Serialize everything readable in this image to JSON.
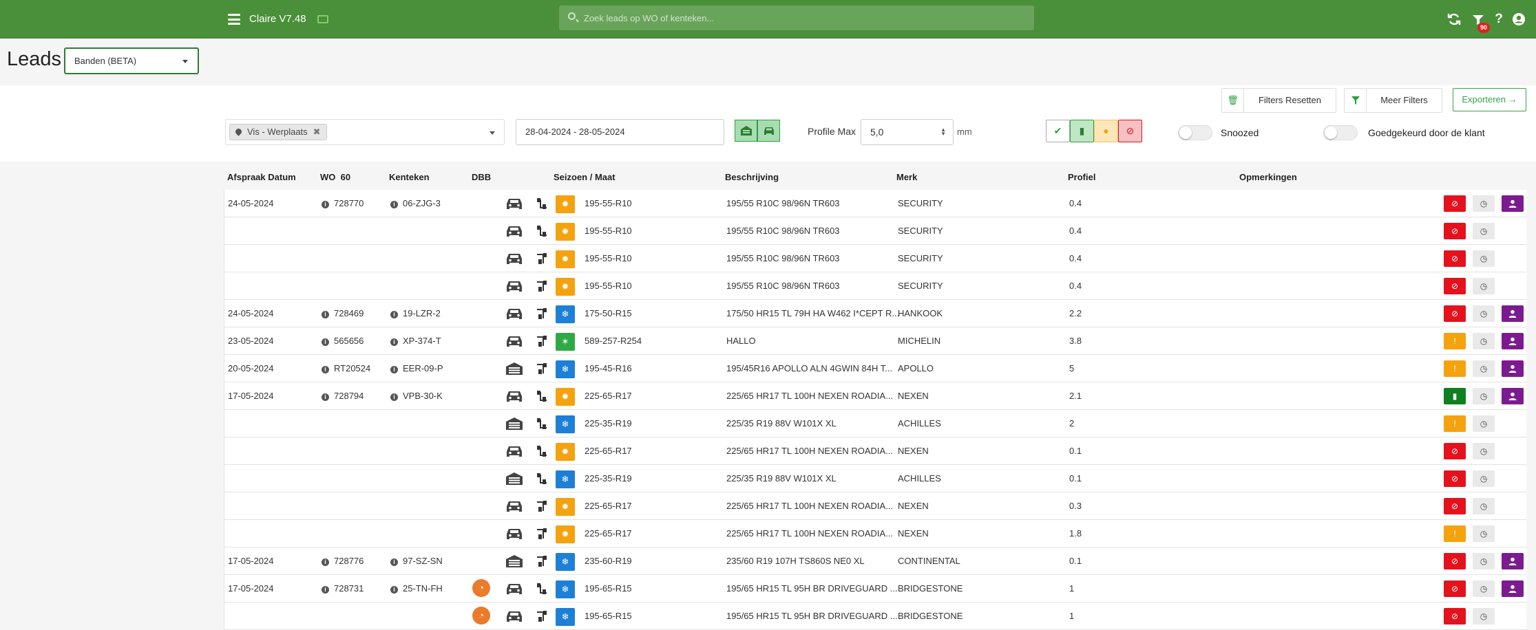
{
  "topbar": {
    "title": "Claire V7.48",
    "search_placeholder": "Zoek leads op WO of kenteken...",
    "badge": "90",
    "icons": [
      "cast-icon",
      "refresh-icon",
      "inbox-icon",
      "help-icon",
      "user-icon"
    ]
  },
  "header": {
    "title": "Leads",
    "type_select": "Banden (BETA)"
  },
  "filters": {
    "reset_label": "Filters Resetten",
    "more_label": "Meer Filters",
    "export_label": "Exporteren",
    "location_chip": "Vis - Werplaats",
    "date_range": "28-04-2024 - 28-05-2024",
    "profile_label": "Profile Max",
    "profile_value": "5,0",
    "profile_unit": "mm",
    "snoozed_label": "Snoozed",
    "approved_label": "Goedgekeurd door de klant",
    "colors": {
      "green": "#35a34a",
      "orange": "#f5a20f",
      "red": "#e3121d",
      "purple": "#7b1b8f"
    }
  },
  "table": {
    "headers": {
      "date": "Afspraak Datum",
      "wo": "WO",
      "wo_count": "60",
      "plate": "Kenteken",
      "dbb": "DBB",
      "season_size": "Seizoen / Maat",
      "description": "Beschrijving",
      "brand": "Merk",
      "profile": "Profiel",
      "remarks": "Opmerkingen"
    },
    "rows": [
      {
        "date": "24-05-2024",
        "wo": "728770",
        "plate": "06-ZJG-3",
        "dbb": false,
        "vehicle": "car",
        "axle": "front",
        "season": "summer",
        "size": "195-55-R10",
        "desc": "195/55 R10C 98/96N TR603",
        "brand": "SECURITY",
        "profile": "0.4",
        "status": "red",
        "user": true
      },
      {
        "date": "",
        "wo": "",
        "plate": "",
        "dbb": false,
        "vehicle": "car",
        "axle": "front",
        "season": "summer",
        "size": "195-55-R10",
        "desc": "195/55 R10C 98/96N TR603",
        "brand": "SECURITY",
        "profile": "0.4",
        "status": "red",
        "user": false
      },
      {
        "date": "",
        "wo": "",
        "plate": "",
        "dbb": false,
        "vehicle": "car",
        "axle": "rear",
        "season": "summer",
        "size": "195-55-R10",
        "desc": "195/55 R10C 98/96N TR603",
        "brand": "SECURITY",
        "profile": "0.4",
        "status": "red",
        "user": false
      },
      {
        "date": "",
        "wo": "",
        "plate": "",
        "dbb": false,
        "vehicle": "car",
        "axle": "rear",
        "season": "summer",
        "size": "195-55-R10",
        "desc": "195/55 R10C 98/96N TR603",
        "brand": "SECURITY",
        "profile": "0.4",
        "status": "red",
        "user": false
      },
      {
        "date": "24-05-2024",
        "wo": "728469",
        "plate": "19-LZR-2",
        "dbb": false,
        "vehicle": "car",
        "axle": "rear",
        "season": "winter",
        "size": "175-50-R15",
        "desc": "175/50 HR15 TL 79H HA W462 I*CEPT R...",
        "brand": "HANKOOK",
        "profile": "2.2",
        "status": "red",
        "user": true
      },
      {
        "date": "23-05-2024",
        "wo": "565656",
        "plate": "XP-374-T",
        "dbb": false,
        "vehicle": "car",
        "axle": "rear",
        "season": "allseason",
        "size": "589-257-R254",
        "desc": "HALLO",
        "brand": "MICHELIN",
        "profile": "3.8",
        "status": "orange",
        "user": true
      },
      {
        "date": "20-05-2024",
        "wo": "RT20524",
        "plate": "EER-09-P",
        "dbb": false,
        "vehicle": "storage",
        "axle": "rear",
        "season": "winter",
        "size": "195-45-R16",
        "desc": "195/45R16 APOLLO ALN 4GWIN 84H T...",
        "brand": "APOLLO",
        "profile": "5",
        "status": "orange",
        "user": true
      },
      {
        "date": "17-05-2024",
        "wo": "728794",
        "plate": "VPB-30-K",
        "dbb": false,
        "vehicle": "car",
        "axle": "front",
        "season": "summer",
        "size": "225-65-R17",
        "desc": "225/65 HR17 TL 100H NEXEN ROADIA...",
        "brand": "NEXEN",
        "profile": "2.1",
        "status": "green",
        "user": true
      },
      {
        "date": "",
        "wo": "",
        "plate": "",
        "dbb": false,
        "vehicle": "storage",
        "axle": "front",
        "season": "winter",
        "size": "225-35-R19",
        "desc": "225/35 R19 88V W101X XL",
        "brand": "ACHILLES",
        "profile": "2",
        "status": "orange",
        "user": false
      },
      {
        "date": "",
        "wo": "",
        "plate": "",
        "dbb": false,
        "vehicle": "car",
        "axle": "front",
        "season": "summer",
        "size": "225-65-R17",
        "desc": "225/65 HR17 TL 100H NEXEN ROADIA...",
        "brand": "NEXEN",
        "profile": "0.1",
        "status": "red",
        "user": false
      },
      {
        "date": "",
        "wo": "",
        "plate": "",
        "dbb": false,
        "vehicle": "storage",
        "axle": "front",
        "season": "winter",
        "size": "225-35-R19",
        "desc": "225/35 R19 88V W101X XL",
        "brand": "ACHILLES",
        "profile": "0.1",
        "status": "red",
        "user": false
      },
      {
        "date": "",
        "wo": "",
        "plate": "",
        "dbb": false,
        "vehicle": "car",
        "axle": "rear",
        "season": "summer",
        "size": "225-65-R17",
        "desc": "225/65 HR17 TL 100H NEXEN ROADIA...",
        "brand": "NEXEN",
        "profile": "0.3",
        "status": "red",
        "user": false
      },
      {
        "date": "",
        "wo": "",
        "plate": "",
        "dbb": false,
        "vehicle": "car",
        "axle": "rear",
        "season": "summer",
        "size": "225-65-R17",
        "desc": "225/65 HR17 TL 100H NEXEN ROADIA...",
        "brand": "NEXEN",
        "profile": "1.8",
        "status": "orange",
        "user": false
      },
      {
        "date": "17-05-2024",
        "wo": "728776",
        "plate": "97-SZ-SN",
        "dbb": false,
        "vehicle": "storage",
        "axle": "rear",
        "season": "winter",
        "size": "235-60-R19",
        "desc": "235/60 R19 107H TS860S NE0 XL",
        "brand": "CONTINENTAL",
        "profile": "0.1",
        "status": "red",
        "user": true
      },
      {
        "date": "17-05-2024",
        "wo": "728731",
        "plate": "25-TN-FH",
        "dbb": true,
        "vehicle": "car",
        "axle": "front",
        "season": "winter",
        "size": "195-65-R15",
        "desc": "195/65 HR15 TL 95H BR DRIVEGUARD ...",
        "brand": "BRIDGESTONE",
        "profile": "1",
        "status": "red",
        "user": true
      },
      {
        "date": "",
        "wo": "",
        "plate": "",
        "dbb": true,
        "vehicle": "car",
        "axle": "rear",
        "season": "winter",
        "size": "195-65-R15",
        "desc": "195/65 HR15 TL 95H BR DRIVEGUARD ...",
        "brand": "BRIDGESTONE",
        "profile": "1",
        "status": "red",
        "user": false
      }
    ]
  }
}
